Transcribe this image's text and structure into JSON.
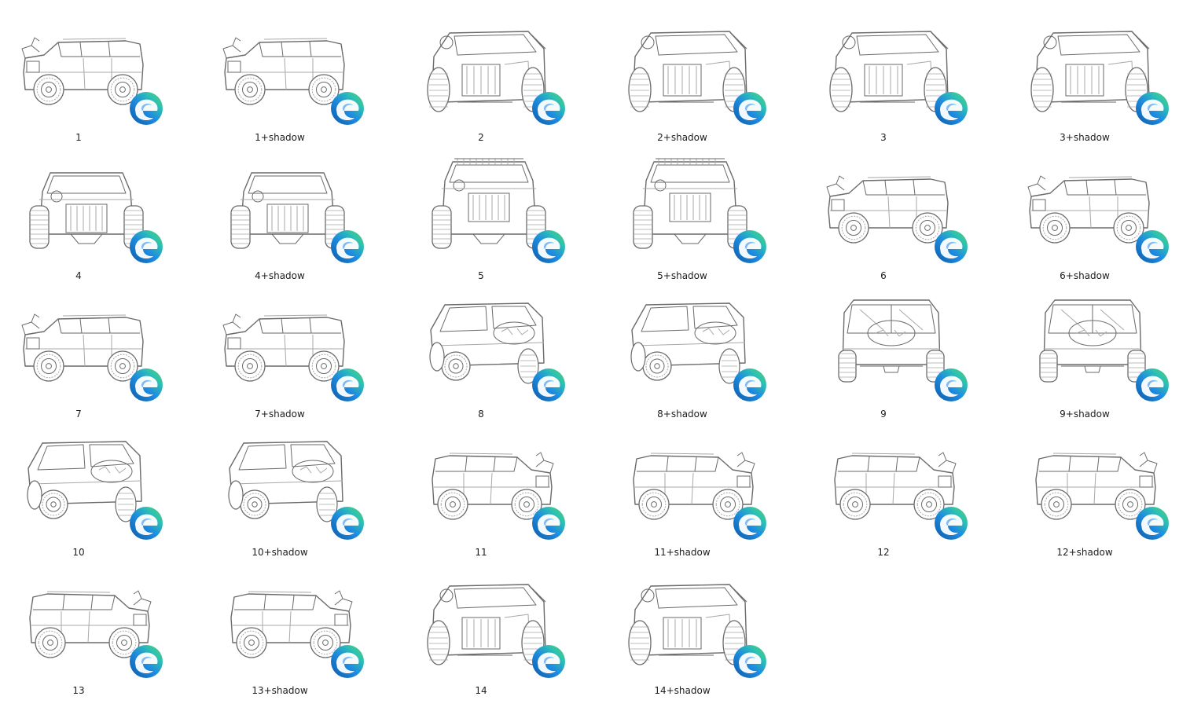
{
  "window": {
    "view": "Large icons"
  },
  "colors": {
    "line": "#6a6a6a",
    "line_light": "#a8a8a8",
    "edge_dark": "#0c59a4",
    "edge_blue": "#1e8ae0",
    "edge_teal": "#2fc2b0",
    "edge_green": "#52d262",
    "label_text": "#202020"
  },
  "files": [
    {
      "name": "1",
      "view": "side-front",
      "icon": "edge-browser-icon"
    },
    {
      "name": "1+shadow",
      "view": "side-front",
      "icon": "edge-browser-icon"
    },
    {
      "name": "2",
      "view": "front-quarter",
      "icon": "edge-browser-icon"
    },
    {
      "name": "2+shadow",
      "view": "front-quarter",
      "icon": "edge-browser-icon"
    },
    {
      "name": "3",
      "view": "front-quarter",
      "icon": "edge-browser-icon"
    },
    {
      "name": "3+shadow",
      "view": "front-quarter",
      "icon": "edge-browser-icon"
    },
    {
      "name": "4",
      "view": "front",
      "icon": "edge-browser-icon"
    },
    {
      "name": "4+shadow",
      "view": "front",
      "icon": "edge-browser-icon"
    },
    {
      "name": "5",
      "view": "front-tall",
      "icon": "edge-browser-icon"
    },
    {
      "name": "5+shadow",
      "view": "front-tall",
      "icon": "edge-browser-icon"
    },
    {
      "name": "6",
      "view": "side-left",
      "icon": "edge-browser-icon"
    },
    {
      "name": "6+shadow",
      "view": "side-left",
      "icon": "edge-browser-icon"
    },
    {
      "name": "7",
      "view": "side-left",
      "icon": "edge-browser-icon"
    },
    {
      "name": "7+shadow",
      "view": "side-left",
      "icon": "edge-browser-icon"
    },
    {
      "name": "8",
      "view": "rear-quarter",
      "icon": "edge-browser-icon"
    },
    {
      "name": "8+shadow",
      "view": "rear-quarter",
      "icon": "edge-browser-icon"
    },
    {
      "name": "9",
      "view": "rear",
      "icon": "edge-browser-icon"
    },
    {
      "name": "9+shadow",
      "view": "rear",
      "icon": "edge-browser-icon"
    },
    {
      "name": "10",
      "view": "rear-quarter",
      "icon": "edge-browser-icon"
    },
    {
      "name": "10+shadow",
      "view": "rear-quarter",
      "icon": "edge-browser-icon"
    },
    {
      "name": "11",
      "view": "side-right",
      "icon": "edge-browser-icon"
    },
    {
      "name": "11+shadow",
      "view": "side-right",
      "icon": "edge-browser-icon"
    },
    {
      "name": "12",
      "view": "side-right",
      "icon": "edge-browser-icon"
    },
    {
      "name": "12+shadow",
      "view": "side-right",
      "icon": "edge-browser-icon"
    },
    {
      "name": "13",
      "view": "side-right",
      "icon": "edge-browser-icon"
    },
    {
      "name": "13+shadow",
      "view": "side-right",
      "icon": "edge-browser-icon"
    },
    {
      "name": "14",
      "view": "front-quarter",
      "icon": "edge-browser-icon"
    },
    {
      "name": "14+shadow",
      "view": "front-quarter",
      "icon": "edge-browser-icon"
    }
  ]
}
